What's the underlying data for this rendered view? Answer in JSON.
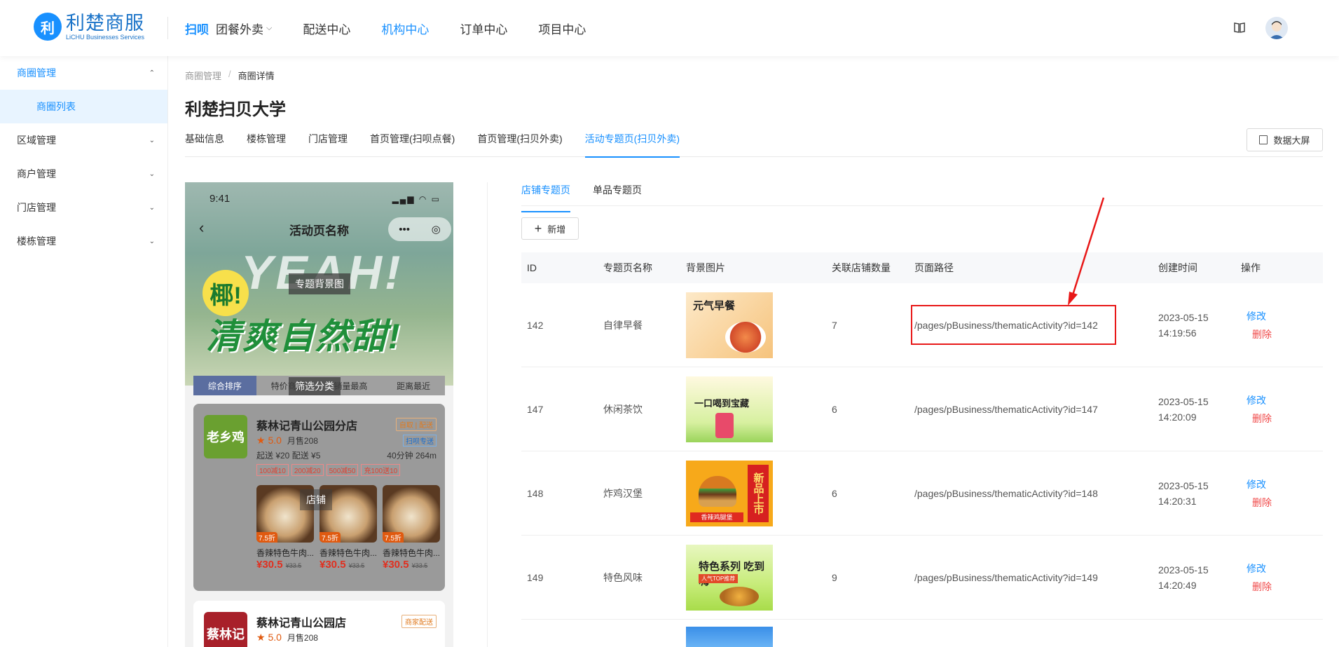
{
  "header": {
    "logo_cn": "利楚商服",
    "logo_en": "LiCHU Businesses Services",
    "logo_mark": "利",
    "nav": [
      {
        "label": "扫呗"
      },
      {
        "label": "团餐外卖"
      },
      {
        "label": "配送中心"
      },
      {
        "label": "机构中心"
      },
      {
        "label": "订单中心"
      },
      {
        "label": "项目中心"
      }
    ]
  },
  "sidebar": {
    "groups": [
      {
        "label": "商圈管理",
        "children": [
          {
            "label": "商圈列表"
          }
        ]
      },
      {
        "label": "区域管理"
      },
      {
        "label": "商户管理"
      },
      {
        "label": "门店管理"
      },
      {
        "label": "楼栋管理"
      }
    ]
  },
  "breadcrumb": {
    "parent": "商圈管理",
    "sep": "/",
    "current": "商圈详情"
  },
  "page_title": "利楚扫贝大学",
  "tabs": [
    "基础信息",
    "楼栋管理",
    "门店管理",
    "首页管理(扫呗点餐)",
    "首页管理(扫贝外卖)",
    "活动专题页(扫贝外卖)"
  ],
  "data_screen_button": "数据大屏",
  "preview": {
    "time": "9:41",
    "signal": "▂▄▆ ◠ ▭",
    "back": "‹",
    "activity_name": "活动页名称",
    "capsule_dots": "•••",
    "capsule_target": "◎",
    "hero_big1": "YEAH!",
    "hero_big2": "清爽自然甜!",
    "hero_badge": "椰!",
    "bg_tag": "专题背景图",
    "filter_tag": "筛选分类",
    "store_tag": "店铺",
    "filters": [
      "综合排序",
      "特价商品",
      "销量最高",
      "距离最近"
    ],
    "store1": {
      "thumb": "老乡鸡",
      "name": "蔡林记青山公园分店",
      "tag": "自取 | 配送",
      "rating": "★ 5.0",
      "sold": "月售208",
      "meta": "起送 ¥20  配送 ¥5",
      "dist": "40分钟  264m",
      "blue_tag": "扫呗专送",
      "coupons": [
        "100减10",
        "200减20",
        "500减50",
        "充100送10"
      ],
      "goods": [
        {
          "name": "香辣特色牛肉...",
          "price": "¥30.5",
          "old": "¥33.5",
          "disc": "7.5折"
        },
        {
          "name": "香辣特色牛肉...",
          "price": "¥30.5",
          "old": "¥33.5",
          "disc": "7.5折"
        },
        {
          "name": "香辣特色牛肉...",
          "price": "¥30.5",
          "old": "¥33.5",
          "disc": "7.5折"
        }
      ]
    },
    "store2": {
      "thumb": "蔡林记",
      "name": "蔡林记青山公园店",
      "tag": "商家配送",
      "rating": "★ 5.0",
      "sold": "月售208"
    }
  },
  "subtabs": [
    "店铺专题页",
    "单品专题页"
  ],
  "add_button": "新增",
  "table": {
    "columns": [
      "ID",
      "专题页名称",
      "背景图片",
      "关联店铺数量",
      "页面路径",
      "创建时间",
      "操作"
    ],
    "rows": [
      {
        "id": "142",
        "name": "自律早餐",
        "count": "7",
        "path": "/pages/pBusiness/thematicActivity?id=142",
        "date": "2023-05-15",
        "time": "14:19:56",
        "img_text": "元气早餐"
      },
      {
        "id": "147",
        "name": "休闲茶饮",
        "count": "6",
        "path": "/pages/pBusiness/thematicActivity?id=147",
        "date": "2023-05-15",
        "time": "14:20:09",
        "img_text": "一口喝到宝藏"
      },
      {
        "id": "148",
        "name": "炸鸡汉堡",
        "count": "6",
        "path": "/pages/pBusiness/thematicActivity?id=148",
        "date": "2023-05-15",
        "time": "14:20:31",
        "img_text": "新品上市",
        "img_sub": "香辣鸡腿堡"
      },
      {
        "id": "149",
        "name": "特色风味",
        "count": "9",
        "path": "/pages/pBusiness/thematicActivity?id=149",
        "date": "2023-05-15",
        "time": "14:20:49",
        "img_text": "特色系列 吃到嗨",
        "img_sub": "人气TOP推荐"
      }
    ],
    "edit_label": "修改",
    "delete_label": "删除"
  },
  "colors": {
    "accent": "#1890ff",
    "danger": "#f04848",
    "highlight": "#e81818"
  }
}
